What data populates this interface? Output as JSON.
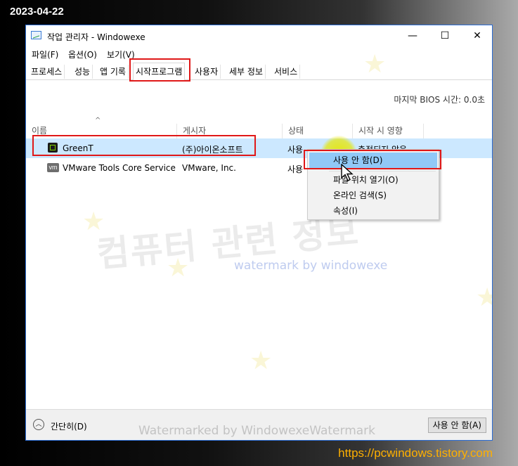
{
  "overlay": {
    "date": "2023-04-22",
    "url": "https://pcwindows.tistory.com",
    "watermark_big": "컴퓨터 관련 정보",
    "watermark_small": "watermark by windowexe",
    "watermark_bottom": "Watermarked by WindowexeWatermark"
  },
  "window": {
    "title": "작업 관리자  - Windowexe",
    "controls": {
      "minimize": "—",
      "maximize": "☐",
      "close": "✕"
    }
  },
  "menu": [
    "파일(F)",
    "옵션(O)",
    "보기(V)"
  ],
  "tabs": [
    {
      "label": "프로세스",
      "active": false
    },
    {
      "label": "성능",
      "active": false
    },
    {
      "label": "앱 기록",
      "active": false
    },
    {
      "label": "시작프로그램",
      "active": true
    },
    {
      "label": "사용자",
      "active": false
    },
    {
      "label": "세부 정보",
      "active": false
    },
    {
      "label": "서비스",
      "active": false
    }
  ],
  "bios_time": "마지막 BIOS 시간:  0.0초",
  "sort_indicator": "^",
  "columns": [
    "이름",
    "게시자",
    "상태",
    "시작 시 영향"
  ],
  "rows": [
    {
      "icon": "greent-icon",
      "name": "GreenT",
      "publisher": "(주)아이온소프트",
      "status": "사용",
      "impact": "측정되지 않음",
      "selected": true
    },
    {
      "icon": "vmware-icon",
      "icon_text": "vm",
      "name": "VMware Tools Core Service",
      "publisher": "VMware, Inc.",
      "status": "사용",
      "impact": "",
      "selected": false
    }
  ],
  "context_menu": [
    {
      "label": "사용 안 함(D)",
      "highlighted": true
    },
    {
      "label": "파일 위치 열기(O)",
      "highlighted": false
    },
    {
      "label": "온라인 검색(S)",
      "highlighted": false
    },
    {
      "label": "속성(I)",
      "highlighted": false
    }
  ],
  "footer": {
    "fewer_details": "간단히(D)",
    "fewer_icon": "chevron-up-icon",
    "disable_button": "사용 안 함(A)"
  },
  "colors": {
    "highlight_box": "#e01818",
    "selection": "#cce8ff",
    "menu_hover": "#91c9f7",
    "url_text": "#ffb000"
  }
}
